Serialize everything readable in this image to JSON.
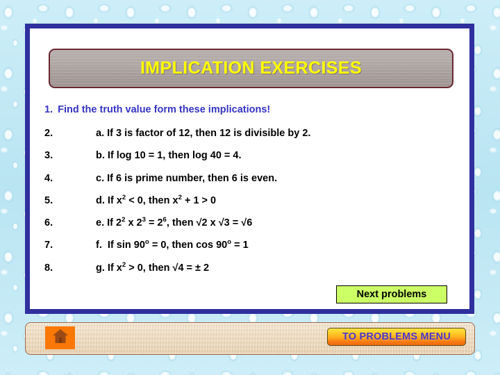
{
  "banner": {
    "title": "IMPLICATION EXERCISES",
    "text_color": "#ffff00",
    "background_color": "#a9a09c"
  },
  "heading": {
    "number": "1.",
    "text": "Find the truth value form these implications!",
    "color": "#3434c4"
  },
  "items": [
    {
      "number": "2.",
      "label": "a.",
      "statement": "If 3 is factor of 12, then 12 is divisible by 2."
    },
    {
      "number": "3.",
      "label": "b.",
      "statement": "If log 10 = 1, then log 40 = 4."
    },
    {
      "number": "4.",
      "label": "c.",
      "statement": "If 6 is prime number, then 6 is even."
    },
    {
      "number": "5.",
      "label": "d.",
      "statement": "If x2 < 0, then x2 + 1 > 0"
    },
    {
      "number": "6.",
      "label": "e.",
      "statement": "If 22 x 23 = 26, then √2 x √3 = √6"
    },
    {
      "number": "7.",
      "label": "f.",
      "statement": "If sin 90º = 0, then cos 90º = 1"
    },
    {
      "number": "8.",
      "label": "g.",
      "statement": "If x2 > 0, then √4 = ± 2"
    }
  ],
  "items_html": [
    "a. If 3 is factor of 12, then 12 is divisible by 2.",
    "b. If log 10 = 1, then log 40 = 4.",
    "c. If 6 is prime number, then 6 is even.",
    "d. If x<sup>2</sup> &lt; 0, then x<sup>2</sup> + 1 &gt; 0",
    "e. If 2<sup>2</sup> x 2<sup>3</sup> = 2<sup>6</sup>, then √2 x √3 = √6",
    "f.&nbsp; If sin 90<sup>o</sup> = 0, then cos 90<sup>o</sup> = 1",
    "g. If x<sup>2</sup> &gt; 0, then √4 = ± 2"
  ],
  "next_button": {
    "label": "Next problems",
    "background_color": "#ccfe66",
    "text_color": "#000000"
  },
  "bottom_bar": {
    "home_icon": "home-icon",
    "home_icon_background": "#f97806",
    "menu_button_label": "TO PROBLEMS MENU",
    "menu_button_text_color": "#4a33c8"
  },
  "panel": {
    "border_color": "#2f2f9e",
    "background_color": "#ffffff"
  },
  "background": {
    "texture": "water-droplets",
    "color": "#c3e9f5"
  }
}
